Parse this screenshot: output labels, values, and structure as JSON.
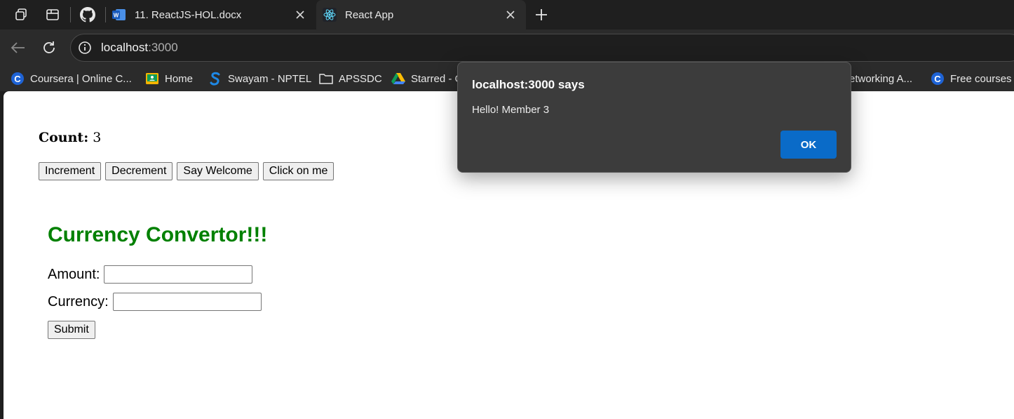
{
  "tabs": [
    {
      "title": "11. ReactJS-HOL.docx",
      "icon": "word-icon"
    },
    {
      "title": "React App",
      "icon": "react-icon",
      "active": true
    }
  ],
  "address": {
    "host": "localhost",
    "port": ":3000"
  },
  "bookmarks": [
    {
      "label": "Coursera | Online C...",
      "icon": "coursera-icon"
    },
    {
      "label": "Home",
      "icon": "classroom-icon"
    },
    {
      "label": "Swayam - NPTEL",
      "icon": "swayam-icon"
    },
    {
      "label": "APSSDC",
      "icon": "folder-icon"
    },
    {
      "label": "Starred - C",
      "icon": "drive-icon"
    },
    {
      "label": "etworking A...",
      "icon": "generic-icon"
    },
    {
      "label": "Free courses t",
      "icon": "coursera-icon"
    }
  ],
  "page": {
    "count_label": "Count:",
    "count_value": "3",
    "buttons": [
      "Increment",
      "Decrement",
      "Say Welcome",
      "Click on me"
    ],
    "converter": {
      "title": "Currency Convertor!!!",
      "amount_label": "Amount:",
      "amount_value": "",
      "currency_label": "Currency:",
      "currency_value": "",
      "submit_label": "Submit"
    }
  },
  "dialog": {
    "title": "localhost:3000 says",
    "message": "Hello! Member 3",
    "ok_label": "OK"
  },
  "colors": {
    "converter_title": "#008000",
    "ok_button": "#0a6bc8"
  }
}
